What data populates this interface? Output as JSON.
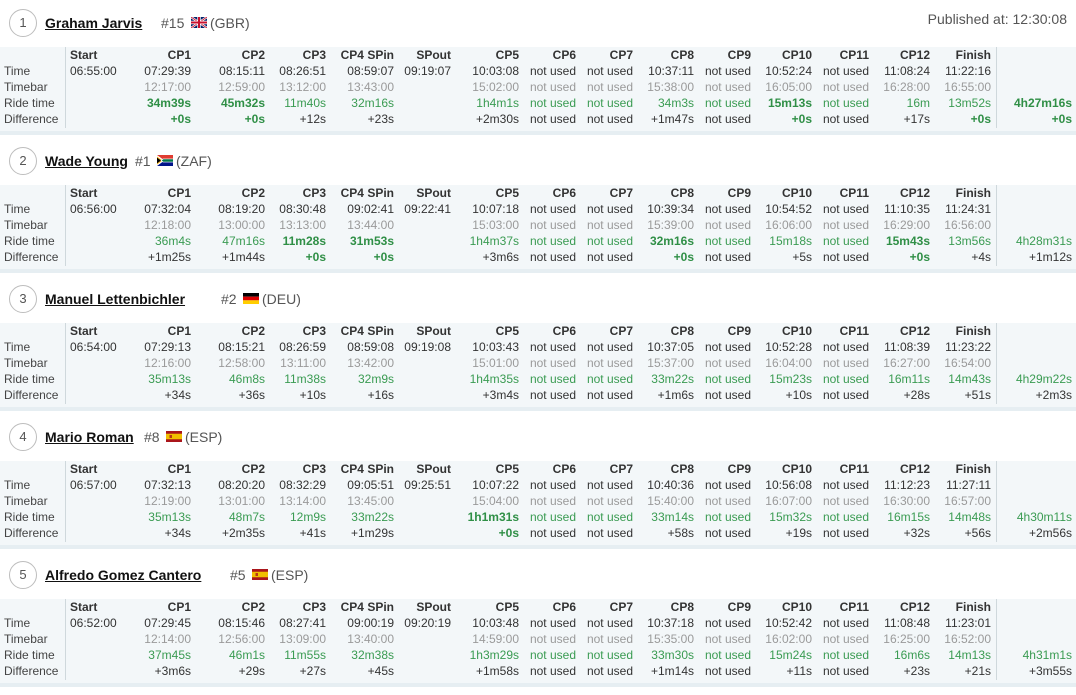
{
  "published": "Published at: 12:30:08",
  "row_labels": [
    "Time",
    "Timebar",
    "Ride time",
    "Difference"
  ],
  "columns": [
    "Start",
    "CP1",
    "CP2",
    "CP3",
    "CP4 SPin",
    "SPout",
    "CP5",
    "CP6",
    "CP7",
    "CP8",
    "CP9",
    "CP10",
    "CP11",
    "CP12",
    "Finish"
  ],
  "not_used": "not used",
  "riders": [
    {
      "rank": "1",
      "name": "Graham Jarvis",
      "number": "#15",
      "country": "(GBR)",
      "flag": "gbr-flag-icon",
      "time": [
        "06:55:00",
        "07:29:39",
        "08:15:11",
        "08:26:51",
        "08:59:07",
        "09:19:07",
        "10:03:08",
        "not used",
        "not used",
        "10:37:11",
        "not used",
        "10:52:24",
        "not used",
        "11:08:24",
        "11:22:16"
      ],
      "timebar": [
        "",
        "12:17:00",
        "12:59:00",
        "13:12:00",
        "13:43:00",
        "",
        "15:02:00",
        "not used",
        "not used",
        "15:38:00",
        "not used",
        "16:05:00",
        "not used",
        "16:28:00",
        "16:55:00"
      ],
      "ride": [
        "",
        "34m39s",
        "45m32s",
        "11m40s",
        "32m16s",
        "",
        "1h4m1s",
        "not used",
        "not used",
        "34m3s",
        "not used",
        "15m13s",
        "not used",
        "16m",
        "13m52s"
      ],
      "ride_best": [
        false,
        true,
        true,
        false,
        false,
        false,
        false,
        false,
        false,
        false,
        false,
        true,
        false,
        false,
        false
      ],
      "diff": [
        "",
        "+0s",
        "+0s",
        "+12s",
        "+23s",
        "",
        "+2m30s",
        "not used",
        "not used",
        "+1m47s",
        "not used",
        "+0s",
        "not used",
        "+17s",
        "+0s"
      ],
      "total_ride": "4h27m16s",
      "total_ride_best": true,
      "total_diff": "+0s"
    },
    {
      "rank": "2",
      "name": "Wade Young",
      "number": "#1",
      "country": "(ZAF)",
      "flag": "zaf-flag-icon",
      "time": [
        "06:56:00",
        "07:32:04",
        "08:19:20",
        "08:30:48",
        "09:02:41",
        "09:22:41",
        "10:07:18",
        "not used",
        "not used",
        "10:39:34",
        "not used",
        "10:54:52",
        "not used",
        "11:10:35",
        "11:24:31"
      ],
      "timebar": [
        "",
        "12:18:00",
        "13:00:00",
        "13:13:00",
        "13:44:00",
        "",
        "15:03:00",
        "not used",
        "not used",
        "15:39:00",
        "not used",
        "16:06:00",
        "not used",
        "16:29:00",
        "16:56:00"
      ],
      "ride": [
        "",
        "36m4s",
        "47m16s",
        "11m28s",
        "31m53s",
        "",
        "1h4m37s",
        "not used",
        "not used",
        "32m16s",
        "not used",
        "15m18s",
        "not used",
        "15m43s",
        "13m56s"
      ],
      "ride_best": [
        false,
        false,
        false,
        true,
        true,
        false,
        false,
        false,
        false,
        true,
        false,
        false,
        false,
        true,
        false
      ],
      "diff": [
        "",
        "+1m25s",
        "+1m44s",
        "+0s",
        "+0s",
        "",
        "+3m6s",
        "not used",
        "not used",
        "+0s",
        "not used",
        "+5s",
        "not used",
        "+0s",
        "+4s"
      ],
      "total_ride": "4h28m31s",
      "total_ride_best": false,
      "total_diff": "+1m12s"
    },
    {
      "rank": "3",
      "name": "Manuel Lettenbichler",
      "number": "#2",
      "country": "(DEU)",
      "flag": "deu-flag-icon",
      "time": [
        "06:54:00",
        "07:29:13",
        "08:15:21",
        "08:26:59",
        "08:59:08",
        "09:19:08",
        "10:03:43",
        "not used",
        "not used",
        "10:37:05",
        "not used",
        "10:52:28",
        "not used",
        "11:08:39",
        "11:23:22"
      ],
      "timebar": [
        "",
        "12:16:00",
        "12:58:00",
        "13:11:00",
        "13:42:00",
        "",
        "15:01:00",
        "not used",
        "not used",
        "15:37:00",
        "not used",
        "16:04:00",
        "not used",
        "16:27:00",
        "16:54:00"
      ],
      "ride": [
        "",
        "35m13s",
        "46m8s",
        "11m38s",
        "32m9s",
        "",
        "1h4m35s",
        "not used",
        "not used",
        "33m22s",
        "not used",
        "15m23s",
        "not used",
        "16m11s",
        "14m43s"
      ],
      "ride_best": [
        false,
        false,
        false,
        false,
        false,
        false,
        false,
        false,
        false,
        false,
        false,
        false,
        false,
        false,
        false
      ],
      "diff": [
        "",
        "+34s",
        "+36s",
        "+10s",
        "+16s",
        "",
        "+3m4s",
        "not used",
        "not used",
        "+1m6s",
        "not used",
        "+10s",
        "not used",
        "+28s",
        "+51s"
      ],
      "total_ride": "4h29m22s",
      "total_ride_best": false,
      "total_diff": "+2m3s"
    },
    {
      "rank": "4",
      "name": "Mario Roman",
      "number": "#8",
      "country": "(ESP)",
      "flag": "esp-flag-icon",
      "time": [
        "06:57:00",
        "07:32:13",
        "08:20:20",
        "08:32:29",
        "09:05:51",
        "09:25:51",
        "10:07:22",
        "not used",
        "not used",
        "10:40:36",
        "not used",
        "10:56:08",
        "not used",
        "11:12:23",
        "11:27:11"
      ],
      "timebar": [
        "",
        "12:19:00",
        "13:01:00",
        "13:14:00",
        "13:45:00",
        "",
        "15:04:00",
        "not used",
        "not used",
        "15:40:00",
        "not used",
        "16:07:00",
        "not used",
        "16:30:00",
        "16:57:00"
      ],
      "ride": [
        "",
        "35m13s",
        "48m7s",
        "12m9s",
        "33m22s",
        "",
        "1h1m31s",
        "not used",
        "not used",
        "33m14s",
        "not used",
        "15m32s",
        "not used",
        "16m15s",
        "14m48s"
      ],
      "ride_best": [
        false,
        false,
        false,
        false,
        false,
        false,
        true,
        false,
        false,
        false,
        false,
        false,
        false,
        false,
        false
      ],
      "diff": [
        "",
        "+34s",
        "+2m35s",
        "+41s",
        "+1m29s",
        "",
        "+0s",
        "not used",
        "not used",
        "+58s",
        "not used",
        "+19s",
        "not used",
        "+32s",
        "+56s"
      ],
      "total_ride": "4h30m11s",
      "total_ride_best": false,
      "total_diff": "+2m56s"
    },
    {
      "rank": "5",
      "name": "Alfredo Gomez Cantero",
      "number": "#5",
      "country": "(ESP)",
      "flag": "esp-flag-icon",
      "time": [
        "06:52:00",
        "07:29:45",
        "08:15:46",
        "08:27:41",
        "09:00:19",
        "09:20:19",
        "10:03:48",
        "not used",
        "not used",
        "10:37:18",
        "not used",
        "10:52:42",
        "not used",
        "11:08:48",
        "11:23:01"
      ],
      "timebar": [
        "",
        "12:14:00",
        "12:56:00",
        "13:09:00",
        "13:40:00",
        "",
        "14:59:00",
        "not used",
        "not used",
        "15:35:00",
        "not used",
        "16:02:00",
        "not used",
        "16:25:00",
        "16:52:00"
      ],
      "ride": [
        "",
        "37m45s",
        "46m1s",
        "11m55s",
        "32m38s",
        "",
        "1h3m29s",
        "not used",
        "not used",
        "33m30s",
        "not used",
        "15m24s",
        "not used",
        "16m6s",
        "14m13s"
      ],
      "ride_best": [
        false,
        false,
        false,
        false,
        false,
        false,
        false,
        false,
        false,
        false,
        false,
        false,
        false,
        false,
        false
      ],
      "diff": [
        "",
        "+3m6s",
        "+29s",
        "+27s",
        "+45s",
        "",
        "+1m58s",
        "not used",
        "not used",
        "+1m14s",
        "not used",
        "+11s",
        "not used",
        "+23s",
        "+21s"
      ],
      "total_ride": "4h31m1s",
      "total_ride_best": false,
      "total_diff": "+3m55s"
    }
  ]
}
